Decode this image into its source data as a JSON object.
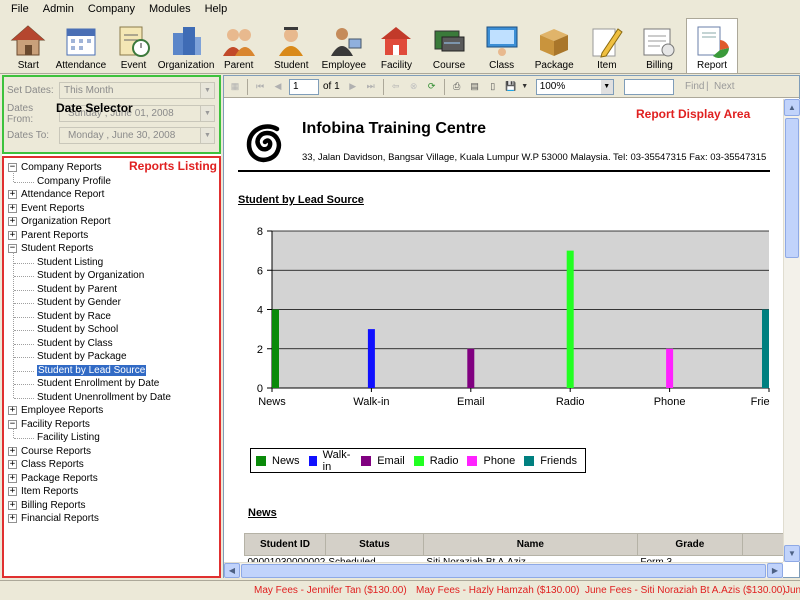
{
  "menu": [
    "File",
    "Admin",
    "Company",
    "Modules",
    "Help"
  ],
  "modules": [
    {
      "label": "Start",
      "icon": "house-icon"
    },
    {
      "label": "Attendance",
      "icon": "calendar-icon"
    },
    {
      "label": "Event",
      "icon": "event-clipboard-icon"
    },
    {
      "label": "Organization",
      "icon": "buildings-icon"
    },
    {
      "label": "Parent",
      "icon": "parents-icon"
    },
    {
      "label": "Student",
      "icon": "student-icon"
    },
    {
      "label": "Employee",
      "icon": "employee-icon"
    },
    {
      "label": "Facility",
      "icon": "facility-icon"
    },
    {
      "label": "Course",
      "icon": "course-icon"
    },
    {
      "label": "Class",
      "icon": "classroom-icon"
    },
    {
      "label": "Package",
      "icon": "package-icon"
    },
    {
      "label": "Item",
      "icon": "pencil-icon"
    },
    {
      "label": "Billing",
      "icon": "billing-icon"
    },
    {
      "label": "Report",
      "icon": "report-chart-icon"
    }
  ],
  "date_selector": {
    "title": "Date Selector",
    "set_dates_label": "Set Dates:",
    "set_dates_value": "This Month",
    "from_label": "Dates From:",
    "from_value": "Sunday ,    June    01, 2008",
    "to_label": "Dates To:",
    "to_value": "Monday  ,    June    30, 2008"
  },
  "reports_listing": {
    "title": "Reports Listing",
    "tree": [
      {
        "label": "Company Reports",
        "expanded": true,
        "children": [
          "Company Profile"
        ]
      },
      {
        "label": "Attendance Report",
        "expanded": false,
        "children": []
      },
      {
        "label": "Event Reports",
        "expanded": false,
        "children": []
      },
      {
        "label": "Organization Report",
        "expanded": false,
        "children": []
      },
      {
        "label": "Parent Reports",
        "expanded": false,
        "children": []
      },
      {
        "label": "Student Reports",
        "expanded": true,
        "children": [
          "Student Listing",
          "Student by Organization",
          "Student by Parent",
          "Student by Gender",
          "Student by Race",
          "Student by School",
          "Student by Class",
          "Student by Package",
          "Student by Lead Source",
          "Student Enrollment by Date",
          "Student Unenrollment by Date"
        ]
      },
      {
        "label": "Employee Reports",
        "expanded": false,
        "children": []
      },
      {
        "label": "Facility Reports",
        "expanded": true,
        "children": [
          "Facility Listing"
        ]
      },
      {
        "label": "Course Reports",
        "expanded": false,
        "children": []
      },
      {
        "label": "Class Reports",
        "expanded": false,
        "children": []
      },
      {
        "label": "Package Reports",
        "expanded": false,
        "children": []
      },
      {
        "label": "Item Reports",
        "expanded": false,
        "children": []
      },
      {
        "label": "Billing Reports",
        "expanded": false,
        "children": []
      },
      {
        "label": "Financial Reports",
        "expanded": false,
        "children": []
      }
    ],
    "selected": "Student by Lead Source"
  },
  "viewer_toolbar": {
    "page_value": "1",
    "page_of": "of  1",
    "zoom": "100%",
    "find_label": "Find",
    "separator": "|",
    "next_label": "Next"
  },
  "report": {
    "area_label": "Report Display Area",
    "company_name": "Infobina Training Centre",
    "company_address": "33, Jalan Davidson, Bangsar Village, Kuala Lumpur W.P 53000 Malaysia. Tel: 03-35547315 Fax: 03-35547315",
    "title": "Student by Lead Source",
    "section_title": "News",
    "table_headers": [
      "Student ID",
      "Status",
      "Name",
      "Grade"
    ],
    "table_rows": [
      [
        "00001030000002",
        "Scheduled",
        "Siti Noraziah Bt A.Aziz",
        "Form 3"
      ]
    ]
  },
  "chart_data": {
    "type": "bar",
    "categories": [
      "News",
      "Walk-in",
      "Email",
      "Radio",
      "Phone",
      "Friends"
    ],
    "values": [
      4,
      3,
      2,
      7,
      2,
      4
    ],
    "colors": [
      "#0a8a0a",
      "#1010ff",
      "#800080",
      "#22ff22",
      "#ff22ff",
      "#008080"
    ],
    "ylim": [
      0,
      8
    ],
    "yticks": [
      0,
      2,
      4,
      6,
      8
    ],
    "grid": true,
    "legend": "bottom-left",
    "xlabel": "",
    "ylabel": ""
  },
  "status_ticker": [
    "May Fees - Jennifer Tan ($130.00)",
    "May Fees - Hazly Hamzah ($130.00)",
    "June Fees - Siti Noraziah Bt A.Azis ($130.00)",
    "Jun"
  ]
}
